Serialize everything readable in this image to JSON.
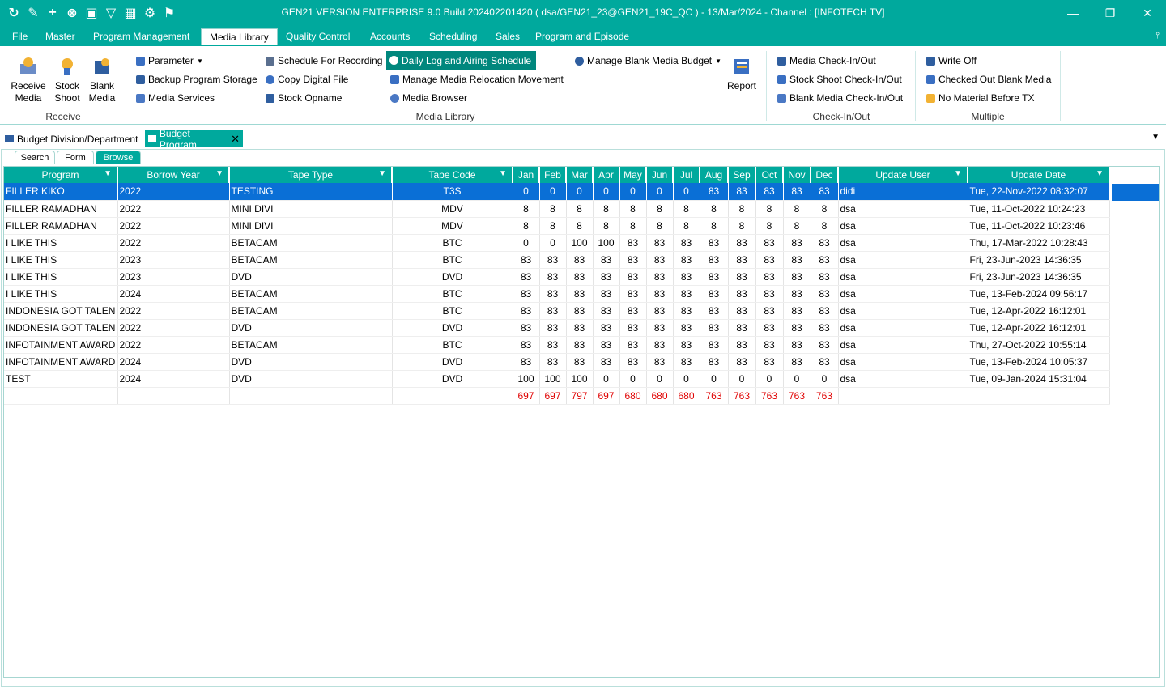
{
  "window": {
    "title": "GEN21 VERSION ENTERPRISE 9.0 Build 202402201420 ( dsa/GEN21_23@GEN21_19C_QC ) - 13/Mar/2024 - Channel : [INFOTECH TV]"
  },
  "menu": [
    "File",
    "Master",
    "Program Management",
    "Media Library",
    "Quality Control",
    "Accounts",
    "Scheduling",
    "Sales",
    "Program and Episode"
  ],
  "ribbon": {
    "receive": {
      "label": "Receive",
      "receive_media": [
        "Receive",
        "Media"
      ],
      "stock_shoot": [
        "Stock",
        "Shoot"
      ],
      "blank_media": [
        "Blank",
        "Media"
      ]
    },
    "media_library": {
      "label": "Media Library",
      "parameter": "Parameter",
      "backup": "Backup Program Storage",
      "media_services": "Media Services",
      "schedule_recording": "Schedule For Recording",
      "copy_digital": "Copy Digital File",
      "stock_opname": "Stock Opname",
      "daily_log": "Daily Log and Airing Schedule",
      "manage_relocation": "Manage Media Relocation Movement",
      "media_browser": "Media Browser",
      "manage_blank_budget": "Manage Blank Media Budget",
      "report": "Report"
    },
    "checkinout": {
      "label": "Check-In/Out",
      "media": "Media Check-In/Out",
      "stock_shoot": "Stock Shoot Check-In/Out",
      "blank_media": "Blank Media Check-In/Out"
    },
    "multiple": {
      "label": "Multiple",
      "write_off": "Write Off",
      "checked_out_blank": "Checked Out Blank Media",
      "no_material": "No Material Before TX"
    }
  },
  "doc_tabs": {
    "tab1": "Budget Division/Department",
    "tab2": "Budget Program"
  },
  "sub_tabs": {
    "search": "Search",
    "form": "Form",
    "browse": "Browse"
  },
  "grid": {
    "columns": [
      "Program",
      "Borrow Year",
      "Tape Type",
      "Tape Code",
      "Jan",
      "Feb",
      "Mar",
      "Apr",
      "May",
      "Jun",
      "Jul",
      "Aug",
      "Sep",
      "Oct",
      "Nov",
      "Dec",
      "Update User",
      "Update Date"
    ],
    "rows": [
      [
        "FILLER KIKO",
        "2022",
        "TESTING",
        "T3S",
        "0",
        "0",
        "0",
        "0",
        "0",
        "0",
        "0",
        "83",
        "83",
        "83",
        "83",
        "83",
        "didi",
        "Tue, 22-Nov-2022 08:32:07"
      ],
      [
        "FILLER RAMADHAN",
        "2022",
        "MINI DIVI",
        "MDV",
        "8",
        "8",
        "8",
        "8",
        "8",
        "8",
        "8",
        "8",
        "8",
        "8",
        "8",
        "8",
        "dsa",
        "Tue, 11-Oct-2022 10:24:23"
      ],
      [
        "FILLER RAMADHAN",
        "2022",
        "MINI DIVI",
        "MDV",
        "8",
        "8",
        "8",
        "8",
        "8",
        "8",
        "8",
        "8",
        "8",
        "8",
        "8",
        "8",
        "dsa",
        "Tue, 11-Oct-2022 10:23:46"
      ],
      [
        "I LIKE THIS",
        "2022",
        "BETACAM",
        "BTC",
        "0",
        "0",
        "100",
        "100",
        "83",
        "83",
        "83",
        "83",
        "83",
        "83",
        "83",
        "83",
        "dsa",
        "Thu, 17-Mar-2022 10:28:43"
      ],
      [
        "I LIKE THIS",
        "2023",
        "BETACAM",
        "BTC",
        "83",
        "83",
        "83",
        "83",
        "83",
        "83",
        "83",
        "83",
        "83",
        "83",
        "83",
        "83",
        "dsa",
        "Fri, 23-Jun-2023 14:36:35"
      ],
      [
        "I LIKE THIS",
        "2023",
        "DVD",
        "DVD",
        "83",
        "83",
        "83",
        "83",
        "83",
        "83",
        "83",
        "83",
        "83",
        "83",
        "83",
        "83",
        "dsa",
        "Fri, 23-Jun-2023 14:36:35"
      ],
      [
        "I LIKE THIS",
        "2024",
        "BETACAM",
        "BTC",
        "83",
        "83",
        "83",
        "83",
        "83",
        "83",
        "83",
        "83",
        "83",
        "83",
        "83",
        "83",
        "dsa",
        "Tue, 13-Feb-2024 09:56:17"
      ],
      [
        "INDONESIA GOT TALEN",
        "2022",
        "BETACAM",
        "BTC",
        "83",
        "83",
        "83",
        "83",
        "83",
        "83",
        "83",
        "83",
        "83",
        "83",
        "83",
        "83",
        "dsa",
        "Tue, 12-Apr-2022 16:12:01"
      ],
      [
        "INDONESIA GOT TALEN",
        "2022",
        "DVD",
        "DVD",
        "83",
        "83",
        "83",
        "83",
        "83",
        "83",
        "83",
        "83",
        "83",
        "83",
        "83",
        "83",
        "dsa",
        "Tue, 12-Apr-2022 16:12:01"
      ],
      [
        "INFOTAINMENT AWARD",
        "2022",
        "BETACAM",
        "BTC",
        "83",
        "83",
        "83",
        "83",
        "83",
        "83",
        "83",
        "83",
        "83",
        "83",
        "83",
        "83",
        "dsa",
        "Thu, 27-Oct-2022 10:55:14"
      ],
      [
        "INFOTAINMENT AWARD",
        "2024",
        "DVD",
        "DVD",
        "83",
        "83",
        "83",
        "83",
        "83",
        "83",
        "83",
        "83",
        "83",
        "83",
        "83",
        "83",
        "dsa",
        "Tue, 13-Feb-2024 10:05:37"
      ],
      [
        "TEST",
        "2024",
        "DVD",
        "DVD",
        "100",
        "100",
        "100",
        "0",
        "0",
        "0",
        "0",
        "0",
        "0",
        "0",
        "0",
        "0",
        "dsa",
        "Tue, 09-Jan-2024 15:31:04"
      ]
    ],
    "totals": [
      "697",
      "697",
      "797",
      "697",
      "680",
      "680",
      "680",
      "763",
      "763",
      "763",
      "763",
      "763"
    ]
  },
  "colors": {
    "accent": "#00a99d",
    "selection": "#0a6fd6",
    "totals": "#e00000"
  }
}
